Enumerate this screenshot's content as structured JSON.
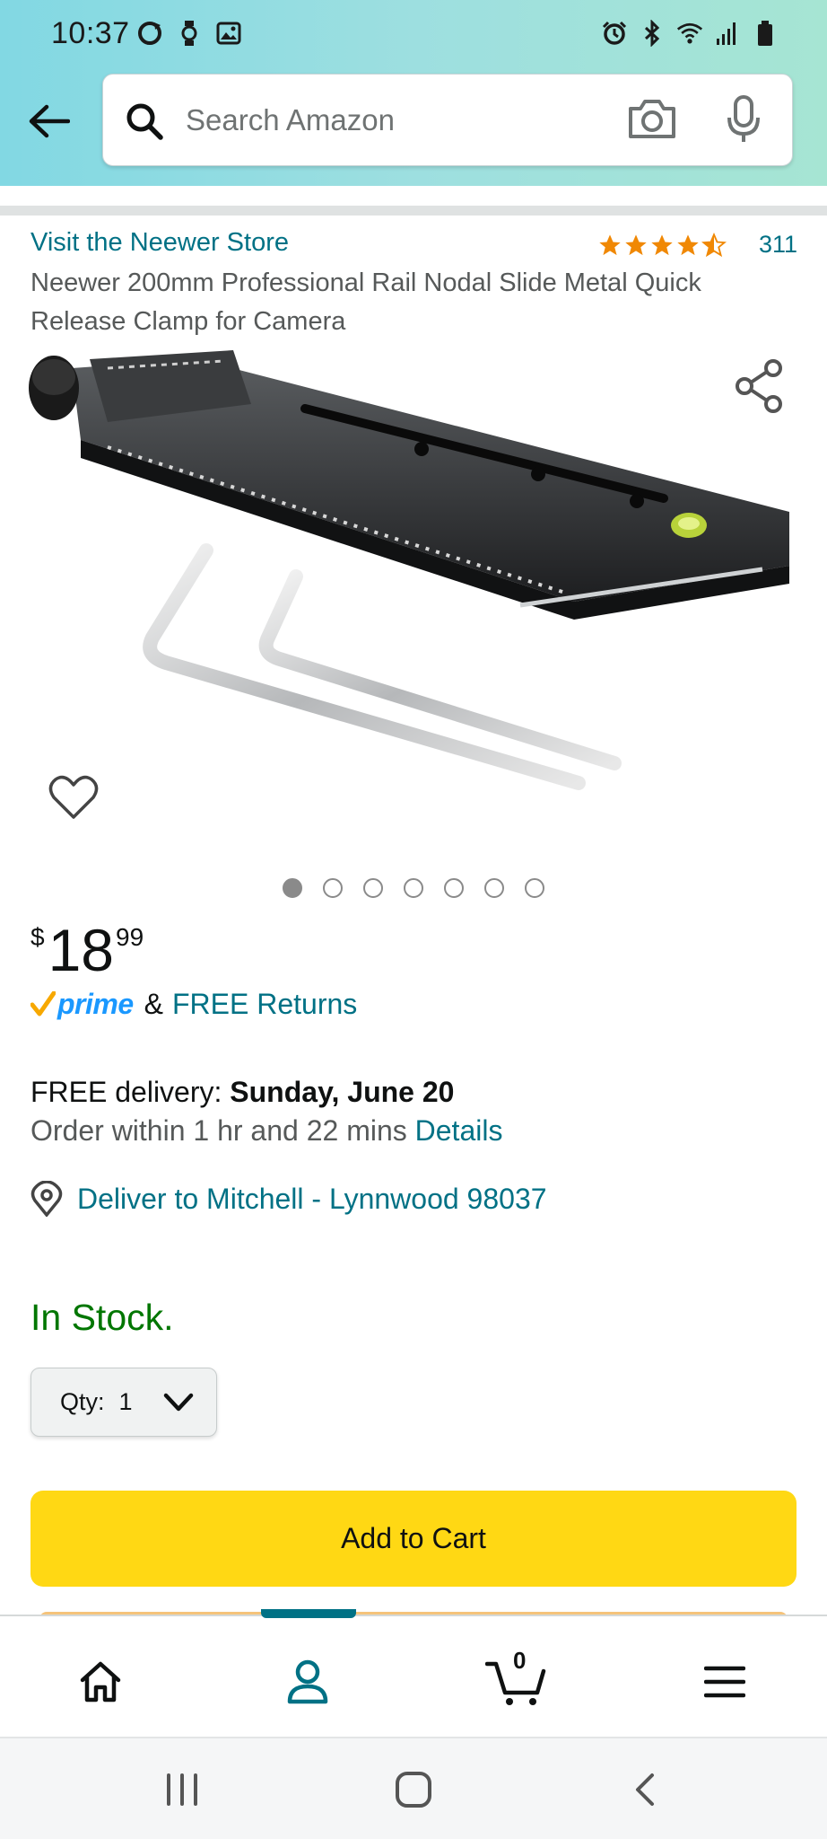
{
  "status_bar": {
    "time": "10:37"
  },
  "search": {
    "placeholder": "Search Amazon"
  },
  "product": {
    "store_link": "Visit the Neewer Store",
    "rating": 4.5,
    "rating_count": "311",
    "title": "Neewer 200mm Professional Rail Nodal Slide Metal Quick Release Clamp for Camera",
    "image_count": 7,
    "active_image_index": 0
  },
  "price": {
    "symbol": "$",
    "whole": "18",
    "fraction": "99"
  },
  "prime": {
    "logo_text": "prime",
    "amp": "&",
    "free_returns": "FREE Returns"
  },
  "delivery": {
    "prefix": "FREE delivery: ",
    "date": "Sunday, June 20",
    "order_within": "Order within 1 hr and 22 mins ",
    "details_link": "Details",
    "deliver_to": "Deliver to Mitchell - Lynnwood 98037"
  },
  "stock": {
    "status": "In Stock."
  },
  "quantity": {
    "label": "Qty:",
    "value": "1"
  },
  "buttons": {
    "add_to_cart": "Add to Cart"
  },
  "bottom_nav": {
    "items": [
      "home-icon",
      "account-icon",
      "cart-icon",
      "menu-icon"
    ],
    "cart_count": "0",
    "active": "account-icon"
  },
  "colors": {
    "link": "#007185",
    "in_stock": "#007600",
    "add_to_cart": "#ffd814",
    "star": "#f08804",
    "prime_blue": "#1a98ff",
    "prime_check": "#f7a800"
  }
}
